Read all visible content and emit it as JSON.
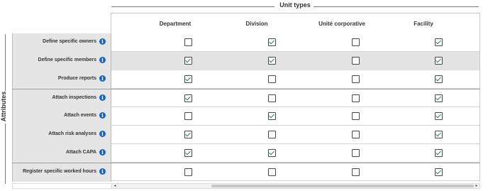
{
  "unit_types_label": "Unit types",
  "attributes_label": "Attributes",
  "columns": [
    "Department",
    "Division",
    "Unité corporative",
    "Facility"
  ],
  "info_glyph": "i",
  "colors": {
    "info_blue": "#1565c0",
    "check_green": "#2e7d6b",
    "row_label_bg": "#e5e5e5",
    "shaded_row": "#e3e3e3"
  },
  "rows": [
    {
      "label": "Define specific owners",
      "values": [
        false,
        true,
        false,
        true
      ]
    },
    {
      "label": "Define specific members",
      "values": [
        true,
        true,
        false,
        true
      ]
    },
    {
      "label": "Produce reports",
      "values": [
        true,
        false,
        false,
        true
      ]
    },
    {
      "label": "Attach inspections",
      "values": [
        true,
        false,
        false,
        true
      ]
    },
    {
      "label": "Attach events",
      "values": [
        false,
        true,
        false,
        true
      ]
    },
    {
      "label": "Attach risk analyses",
      "values": [
        true,
        false,
        false,
        true
      ]
    },
    {
      "label": "Attach CAPA",
      "values": [
        true,
        true,
        false,
        true
      ]
    },
    {
      "label": "Register specific worked hours",
      "values": [
        false,
        false,
        false,
        true
      ]
    }
  ],
  "scrollbar": {
    "left_arrow": "◂",
    "right_arrow": "▸"
  }
}
